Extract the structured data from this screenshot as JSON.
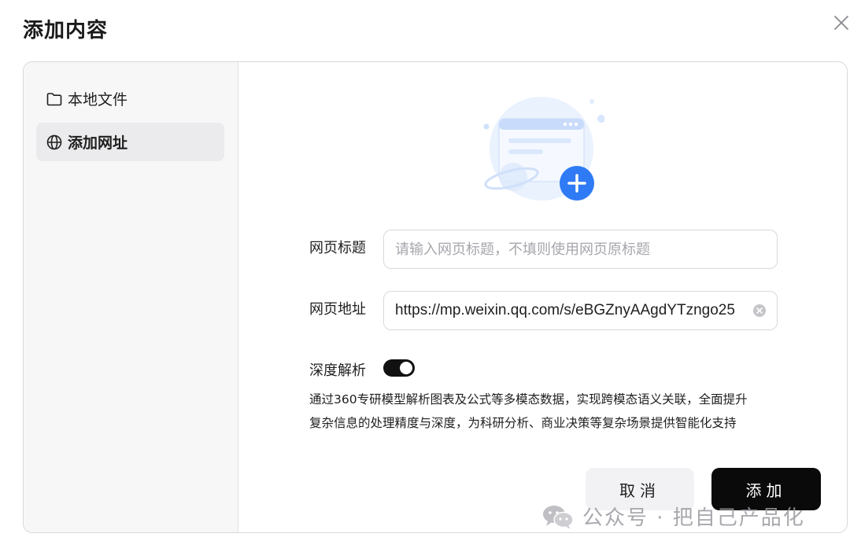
{
  "dialog": {
    "title": "添加内容"
  },
  "sidebar": {
    "items": [
      {
        "label": "本地文件",
        "icon": "folder-icon",
        "active": false
      },
      {
        "label": "添加网址",
        "icon": "globe-icon",
        "active": true
      }
    ]
  },
  "form": {
    "title_label": "网页标题",
    "title_placeholder": "请输入网页标题，不填则使用网页原标题",
    "title_value": "",
    "url_label": "网页地址",
    "url_value": "https://mp.weixin.qq.com/s/eBGZnyAAgdYTzngo25",
    "deep_parse_label": "深度解析",
    "deep_parse_enabled": true,
    "description_line1": "通过360专研模型解析图表及公式等多模态数据，实现跨模态语义关联，全面提升",
    "description_line2": "复杂信息的处理精度与深度，为科研分析、商业决策等复杂场景提供智能化支持"
  },
  "buttons": {
    "cancel_label": "取消",
    "add_label": "添加"
  },
  "watermark": {
    "text": "公众号 · 把自己产品化"
  },
  "colors": {
    "accent_blue": "#2f7bf5",
    "primary_button": "#0a0a0a",
    "toggle_on": "#111111"
  }
}
